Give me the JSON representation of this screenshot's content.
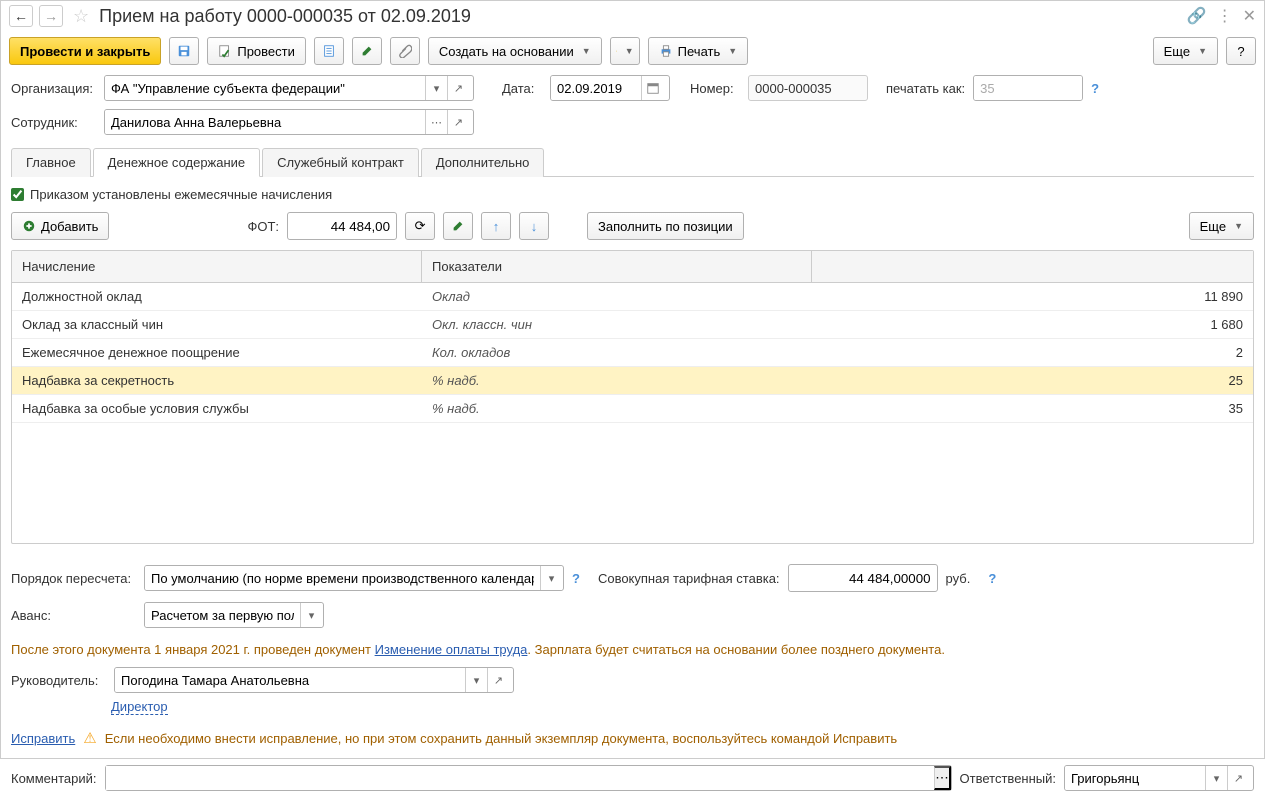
{
  "title": "Прием на работу 0000-000035 от 02.09.2019",
  "toolbar": {
    "post_and_close": "Провести и закрыть",
    "post": "Провести",
    "create_based": "Создать на основании",
    "print": "Печать",
    "more": "Еще"
  },
  "form": {
    "org_label": "Организация:",
    "org_value": "ФА \"Управление субъекта федерации\"",
    "date_label": "Дата:",
    "date_value": "02.09.2019",
    "number_label": "Номер:",
    "number_value": "0000-000035",
    "print_as_label": "печатать как:",
    "print_as_value": "35",
    "employee_label": "Сотрудник:",
    "employee_value": "Данилова Анна Валерьевна"
  },
  "tabs": {
    "main": "Главное",
    "salary": "Денежное содержание",
    "contract": "Служебный контракт",
    "additional": "Дополнительно"
  },
  "salary_tab": {
    "monthly_checkbox": "Приказом установлены ежемесячные начисления",
    "add_button": "Добавить",
    "fot_label": "ФОТ:",
    "fot_value": "44 484,00",
    "fill_by_position": "Заполнить по позиции",
    "more": "Еще",
    "table": {
      "header_accrual": "Начисление",
      "header_indicators": "Показатели",
      "rows": [
        {
          "name": "Должностной оклад",
          "indicator": "Оклад",
          "value": "11 890"
        },
        {
          "name": "Оклад за классный чин",
          "indicator": "Окл. классн. чин",
          "value": "1 680"
        },
        {
          "name": "Ежемесячное денежное поощрение",
          "indicator": "Кол. окладов",
          "value": "2"
        },
        {
          "name": "Надбавка за секретность",
          "indicator": "% надб.",
          "value": "25"
        },
        {
          "name": "Надбавка за особые условия службы",
          "indicator": "% надб.",
          "value": "35"
        }
      ]
    },
    "recalc_label": "Порядок пересчета:",
    "recalc_value": "По умолчанию (по норме времени производственного календаря)",
    "total_rate_label": "Совокупная тарифная ставка:",
    "total_rate_value": "44 484,00000",
    "total_rate_unit": "руб.",
    "advance_label": "Аванс:",
    "advance_value": "Расчетом за первую половину месяца"
  },
  "footer": {
    "info_prefix": "После этого документа 1 января 2021 г. проведен документ ",
    "info_link": "Изменение оплаты труда",
    "info_suffix": ". Зарплата будет считаться на основании более позднего документа.",
    "manager_label": "Руководитель:",
    "manager_value": "Погодина Тамара Анатольевна",
    "manager_position": "Директор",
    "fix_link": "Исправить",
    "warning": "Если необходимо внести исправление, но при этом сохранить данный экземпляр документа, воспользуйтесь командой Исправить",
    "comment_label": "Комментарий:",
    "responsible_label": "Ответственный:",
    "responsible_value": "Григорьянц"
  }
}
